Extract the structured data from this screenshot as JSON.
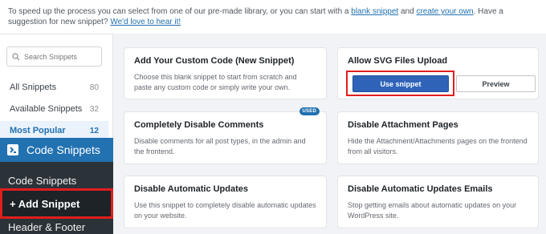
{
  "intro": {
    "text_before": "To speed up the process you can select from one of our pre-made library, or you can start with a ",
    "link_blank": "blank snippet",
    "text_and": " and ",
    "link_create": "create your own",
    "text_suggest": ". Have a suggestion for new snippet? ",
    "link_love": "We'd love to hear it!"
  },
  "filter": {
    "search_placeholder": "Search Snippets",
    "categories": [
      {
        "label": "All Snippets",
        "count": "80"
      },
      {
        "label": "Available Snippets",
        "count": "32"
      },
      {
        "label": "Most Popular",
        "count": "12"
      }
    ]
  },
  "wp_menu": {
    "header": "Code Snippets",
    "items": [
      "Code Snippets",
      "+ Add Snippet",
      "Header & Footer"
    ]
  },
  "cards": [
    {
      "title": "Add Your Custom Code (New Snippet)",
      "desc": "Choose this blank snippet to start from scratch and paste any custom code or simply write your own."
    },
    {
      "title": "Allow SVG Files Upload",
      "use_label": "Use snippet",
      "preview_label": "Preview"
    },
    {
      "title": "Completely Disable Comments",
      "badge": "USED",
      "desc": "Disable comments for all post types, in the admin and the frontend."
    },
    {
      "title": "Disable Attachment Pages",
      "desc": "Hide the Attachment/Attachments pages on the frontend from all visitors."
    },
    {
      "title": "Disable Automatic Updates",
      "desc": "Use this snippet to completely disable automatic updates on your website."
    },
    {
      "title": "Disable Automatic Updates Emails",
      "desc": "Stop getting emails about automatic updates on your WordPress site."
    }
  ],
  "colors": {
    "accent": "#2271b1",
    "highlight": "#e01e1e",
    "admin_bg": "#2c3338"
  }
}
